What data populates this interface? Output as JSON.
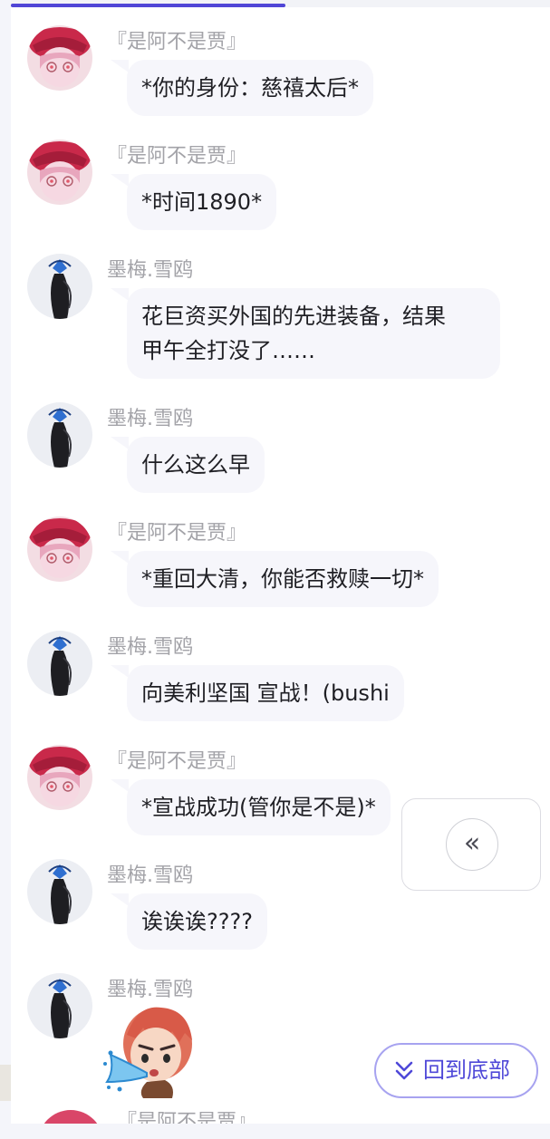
{
  "progress": {
    "fraction": 0.51,
    "color": "#5046d6"
  },
  "users": {
    "jia": {
      "name": "『是阿不是贾』",
      "avatar_icon": "pink-hair-girl-avatar"
    },
    "mo": {
      "name": "墨梅.雪鸥",
      "avatar_icon": "blue-butterfly-silhouette-avatar"
    }
  },
  "messages": [
    {
      "user": "jia",
      "nick": "『是阿不是贾』",
      "lines": [
        "*你的身份：慈禧太后*"
      ]
    },
    {
      "user": "jia",
      "nick": "『是阿不是贾』",
      "lines": [
        "*时间1890*"
      ]
    },
    {
      "user": "mo",
      "nick": "墨梅.雪鸥",
      "lines": [
        "花巨资买外国的先进装备，结果",
        "甲午全打没了……"
      ]
    },
    {
      "user": "mo",
      "nick": "墨梅.雪鸥",
      "lines": [
        "什么这么早"
      ]
    },
    {
      "user": "jia",
      "nick": "『是阿不是贾』",
      "lines": [
        "*重回大清，你能否救赎一切*"
      ]
    },
    {
      "user": "mo",
      "nick": "墨梅.雪鸥",
      "lines": [
        "向美利坚国 宣战！(bushi"
      ]
    },
    {
      "user": "jia",
      "nick": "『是阿不是贾』",
      "lines": [
        "*宣战成功(管你是不是)*"
      ]
    },
    {
      "user": "mo",
      "nick": "墨梅.雪鸥",
      "lines": [
        "诶诶诶????"
      ]
    },
    {
      "user": "mo",
      "nick": "墨梅.雪鸥",
      "sticker": "red-haired-boy-spitting-water-sticker"
    }
  ],
  "partial_message": {
    "nick": "『是阿不是贾』"
  },
  "controls": {
    "collapse_icon": "double-chevron-left-icon",
    "collapse_glyph": "«",
    "scroll_bottom_label": "回到底部",
    "scroll_bottom_icon": "double-chevron-down-icon",
    "accent": "#4f48d8"
  }
}
